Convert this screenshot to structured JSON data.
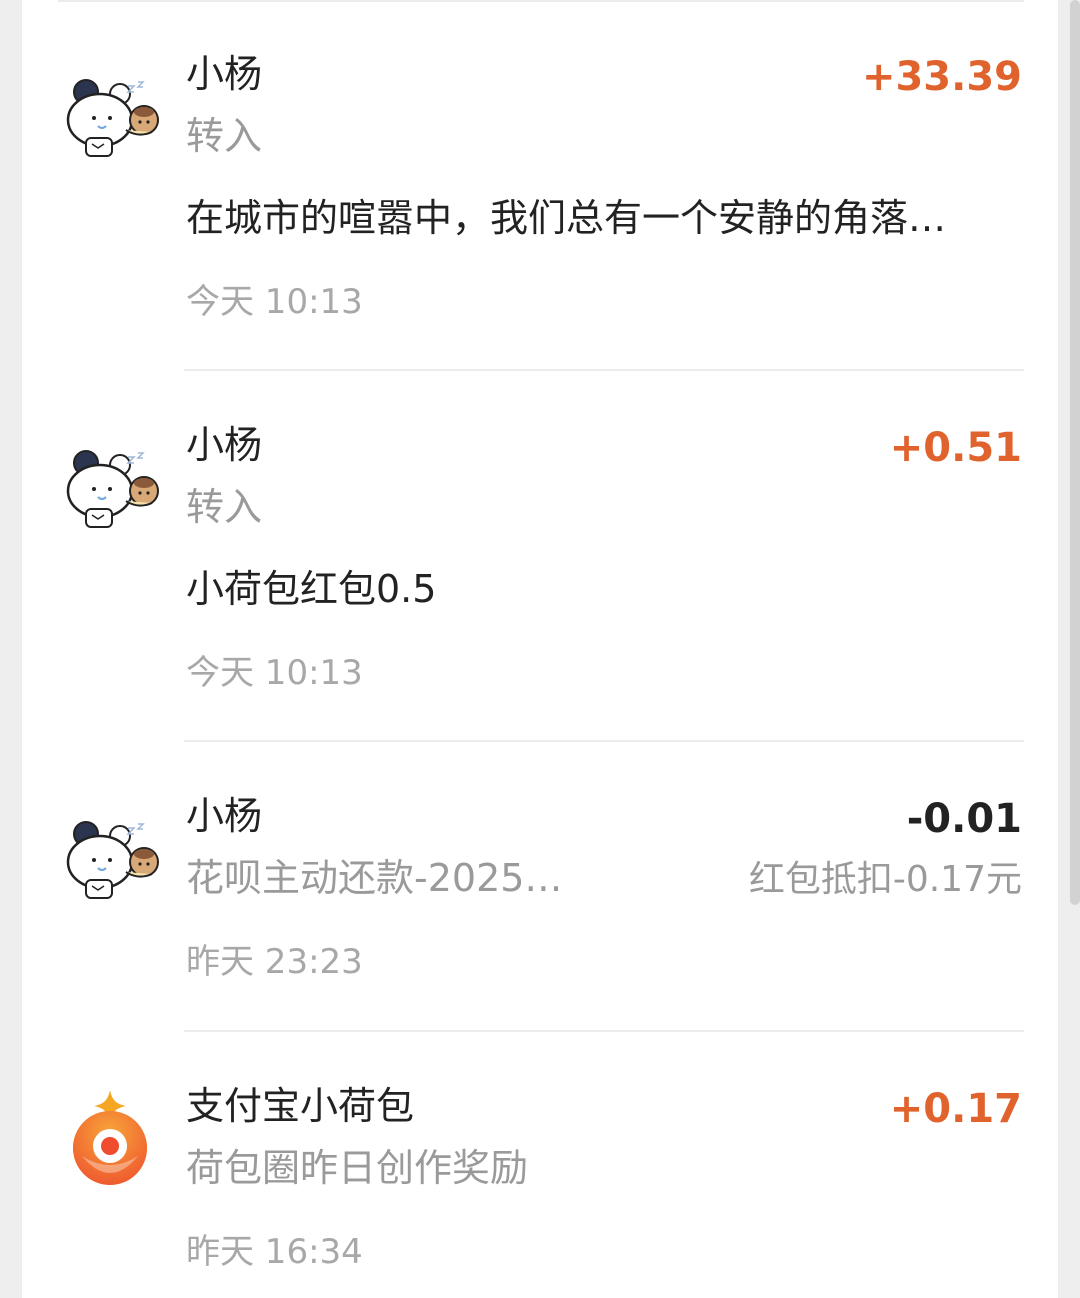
{
  "colors": {
    "income": "#e0622d",
    "expense": "#222222",
    "secondary_text": "#9a9a9a",
    "primary_text": "#222222"
  },
  "transactions": [
    {
      "avatar_icon": "cartoon-bear-avatar-icon",
      "name": "小杨",
      "type": "转入",
      "memo": "在城市的喧嚣中，我们总有一个安静的角落…",
      "time": "今天 10:13",
      "amount": "+33.39",
      "direction": "income"
    },
    {
      "avatar_icon": "cartoon-bear-avatar-icon",
      "name": "小杨",
      "type": "转入",
      "memo": "小荷包红包0.5",
      "time": "今天 10:13",
      "amount": "+0.51",
      "direction": "income"
    },
    {
      "avatar_icon": "cartoon-bear-avatar-icon",
      "name": "小杨",
      "type": "花呗主动还款-2025…",
      "note": "红包抵扣-0.17元",
      "time": "昨天 23:23",
      "amount": "-0.01",
      "direction": "expense"
    },
    {
      "avatar_icon": "alipay-pocket-logo-icon",
      "name": "支付宝小荷包",
      "type": "荷包圈昨日创作奖励",
      "time": "昨天 16:34",
      "amount": "+0.17",
      "direction": "income"
    }
  ]
}
